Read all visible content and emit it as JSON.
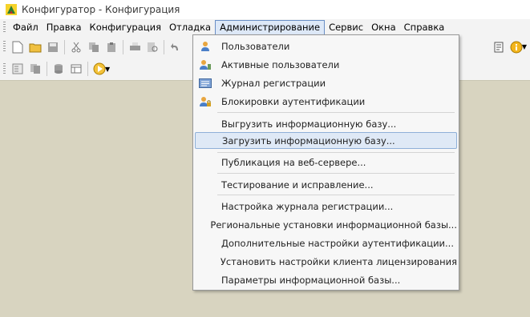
{
  "window": {
    "title": "Конфигуратор - Конфигурация"
  },
  "menubar": {
    "items": [
      {
        "label": "Файл"
      },
      {
        "label": "Правка"
      },
      {
        "label": "Конфигурация"
      },
      {
        "label": "Отладка"
      },
      {
        "label": "Администрирование"
      },
      {
        "label": "Сервис"
      },
      {
        "label": "Окна"
      },
      {
        "label": "Справка"
      }
    ]
  },
  "menu": {
    "items": [
      {
        "label": "Пользователи",
        "icon": "user-icon"
      },
      {
        "label": "Активные пользователи",
        "icon": "active-users-icon"
      },
      {
        "label": "Журнал регистрации",
        "icon": "event-log-icon"
      },
      {
        "label": "Блокировки аутентификации",
        "icon": "auth-lock-icon"
      },
      {
        "label": "Выгрузить информационную базу..."
      },
      {
        "label": "Загрузить информационную базу..."
      },
      {
        "label": "Публикация на веб-сервере..."
      },
      {
        "label": "Тестирование и исправление..."
      },
      {
        "label": "Настройка журнала регистрации..."
      },
      {
        "label": "Региональные установки информационной базы..."
      },
      {
        "label": "Дополнительные настройки аутентификации..."
      },
      {
        "label": "Установить настройки клиента лицензирования"
      },
      {
        "label": "Параметры информационной базы..."
      }
    ]
  },
  "colors": {
    "workspace": "#d8d4c0",
    "highlight": "#dfe9f6",
    "accent": "#6a8fc6"
  }
}
